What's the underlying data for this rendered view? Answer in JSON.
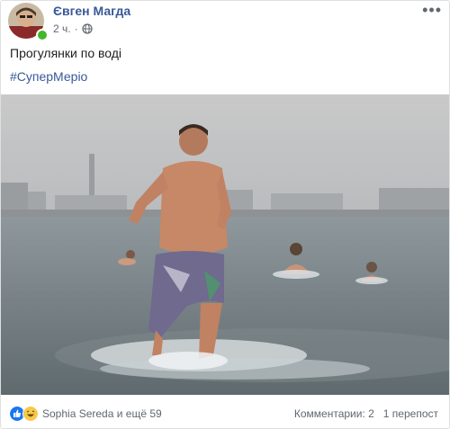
{
  "post": {
    "author": "Євген Магда",
    "time": "2 ч.",
    "privacy_icon": "globe-icon",
    "more_icon": "more-icon",
    "text": "Прогулянки по воді",
    "hashtag": "#СуперМеріо"
  },
  "footer": {
    "reactions_label": "Sophia Sereda и ещё 59",
    "reaction_icons": [
      "like-icon",
      "haha-icon"
    ],
    "comments_label": "Комментарии: 2",
    "shares_label": "1 перепост"
  },
  "colors": {
    "link": "#385898",
    "like": "#1877f2",
    "online": "#42b72a",
    "meta": "#616770"
  }
}
